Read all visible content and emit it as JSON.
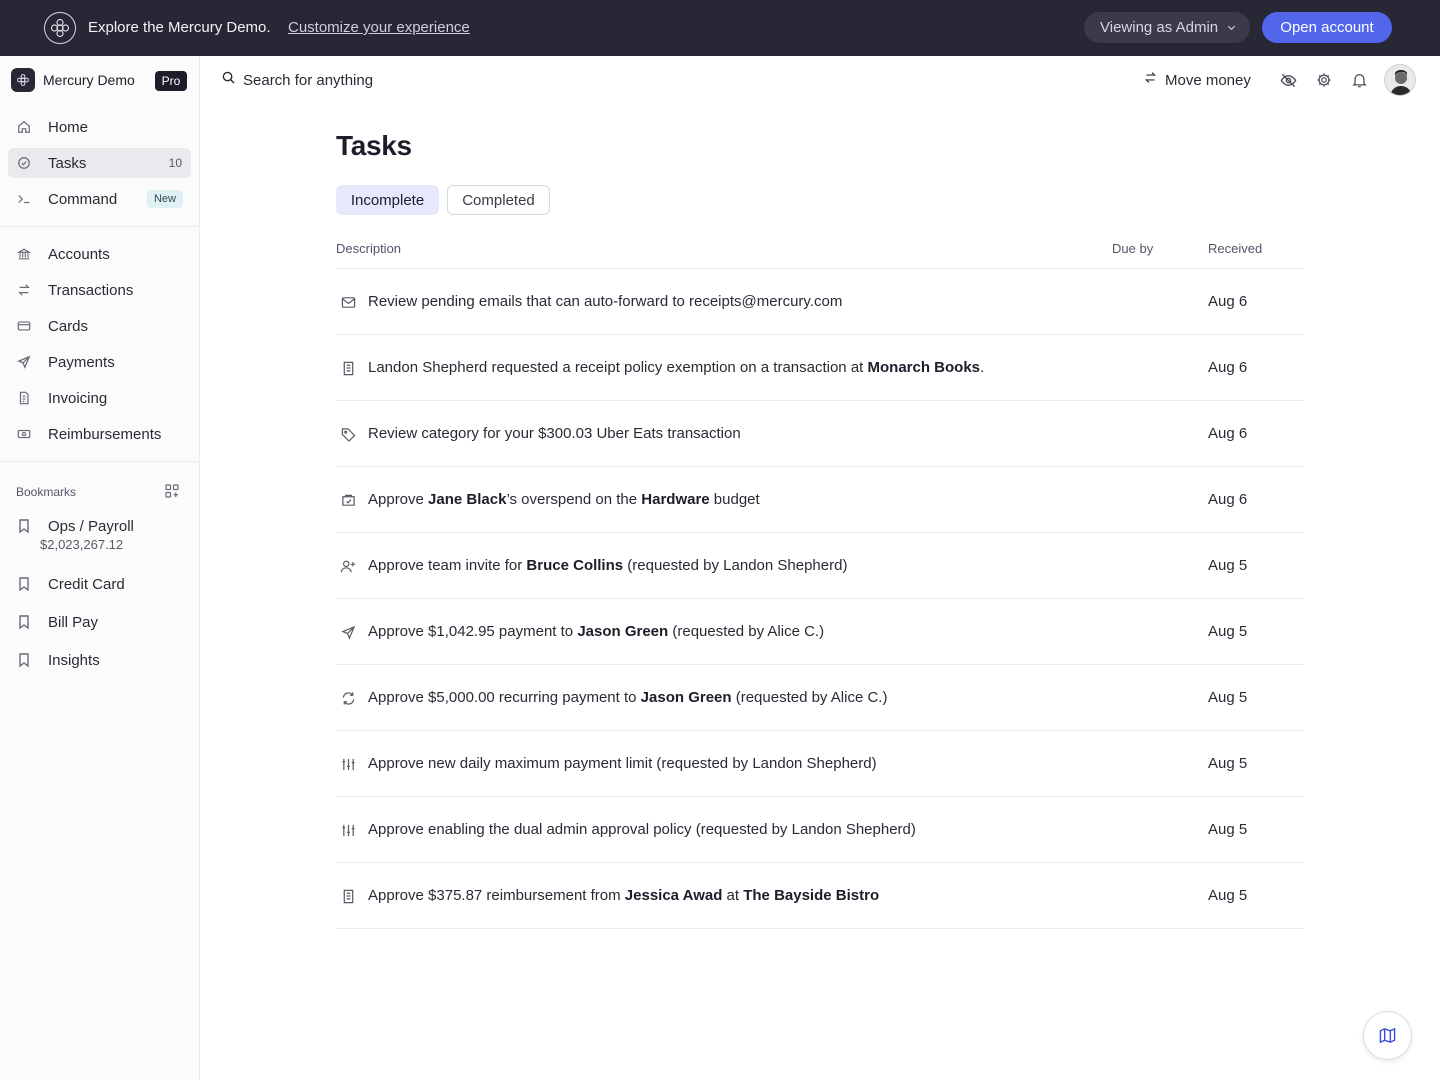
{
  "banner": {
    "text": "Explore the Mercury Demo.",
    "link": "Customize your experience",
    "viewing": "Viewing as Admin",
    "open_account": "Open account"
  },
  "sidebar": {
    "org_name": "Mercury Demo",
    "plan_badge": "Pro",
    "nav": [
      {
        "label": "Home",
        "icon": "home-icon"
      },
      {
        "label": "Tasks",
        "icon": "check-circle-icon",
        "count": "10"
      },
      {
        "label": "Command",
        "icon": "terminal-icon",
        "badge": "New"
      },
      {
        "label": "Accounts",
        "icon": "bank-icon"
      },
      {
        "label": "Transactions",
        "icon": "arrows-icon"
      },
      {
        "label": "Cards",
        "icon": "card-icon"
      },
      {
        "label": "Payments",
        "icon": "send-icon"
      },
      {
        "label": "Invoicing",
        "icon": "invoice-icon"
      },
      {
        "label": "Reimbursements",
        "icon": "cash-icon"
      }
    ],
    "bookmarks_title": "Bookmarks",
    "bookmarks": [
      {
        "label": "Ops / Payroll",
        "sub": "$2,023,267.12"
      },
      {
        "label": "Credit Card"
      },
      {
        "label": "Bill Pay"
      },
      {
        "label": "Insights"
      }
    ]
  },
  "header": {
    "search_label": "Search for anything",
    "move_money": "Move money"
  },
  "main": {
    "title": "Tasks",
    "tabs": [
      "Incomplete",
      "Completed"
    ],
    "columns": [
      "Description",
      "Due by",
      "Received"
    ],
    "rows": [
      {
        "icon": "mail-icon",
        "parts": [
          "Review pending emails that can auto-forward to receipts@mercury.com"
        ],
        "bold": [],
        "due": "",
        "received": "Aug 6"
      },
      {
        "icon": "receipt-icon",
        "parts": [
          "Landon Shepherd requested a receipt policy exemption on a transaction at ",
          "Monarch Books",
          "."
        ],
        "bold": [
          1
        ],
        "due": "",
        "received": "Aug 6"
      },
      {
        "icon": "tag-icon",
        "parts": [
          "Review category for your $300.03 Uber Eats transaction"
        ],
        "bold": [],
        "due": "",
        "received": "Aug 6"
      },
      {
        "icon": "budget-icon",
        "parts": [
          "Approve ",
          "Jane Black",
          "’s overspend on the ",
          "Hardware",
          " budget"
        ],
        "bold": [
          1,
          3
        ],
        "due": "",
        "received": "Aug 6"
      },
      {
        "icon": "user-plus-icon",
        "parts": [
          "Approve team invite for ",
          "Bruce Collins",
          " (requested by Landon Shepherd)"
        ],
        "bold": [
          1
        ],
        "due": "",
        "received": "Aug 5"
      },
      {
        "icon": "send-icon",
        "parts": [
          "Approve $1,042.95 payment to ",
          "Jason Green",
          " (requested by Alice C.)"
        ],
        "bold": [
          1
        ],
        "due": "",
        "received": "Aug 5"
      },
      {
        "icon": "recurring-icon",
        "parts": [
          "Approve $5,000.00 recurring payment to ",
          "Jason Green",
          " (requested by Alice C.)"
        ],
        "bold": [
          1
        ],
        "due": "",
        "received": "Aug 5"
      },
      {
        "icon": "sliders-icon",
        "parts": [
          "Approve new daily maximum payment limit (requested by Landon Shepherd)"
        ],
        "bold": [],
        "due": "",
        "received": "Aug 5"
      },
      {
        "icon": "sliders-icon",
        "parts": [
          "Approve enabling the dual admin approval policy (requested by Landon Shepherd)"
        ],
        "bold": [],
        "due": "",
        "received": "Aug 5"
      },
      {
        "icon": "receipt-icon",
        "parts": [
          "Approve $375.87 reimbursement from ",
          "Jessica Awad",
          " at ",
          "The Bayside Bistro"
        ],
        "bold": [
          1,
          3
        ],
        "due": "",
        "received": "Aug 5"
      }
    ]
  },
  "colors": {
    "banner_bg": "#272735",
    "accent": "#5266eb",
    "active_tab": "#e6e8fb"
  }
}
